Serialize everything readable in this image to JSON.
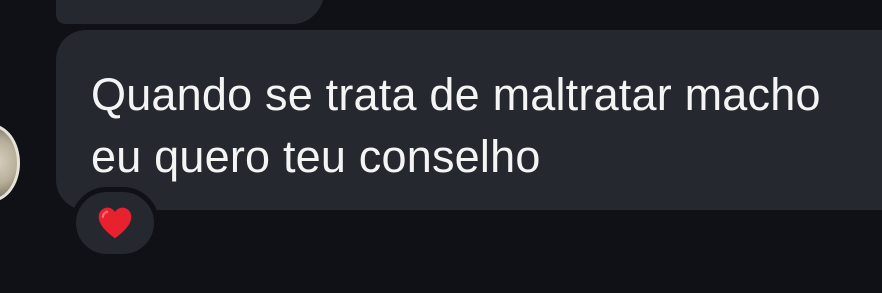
{
  "conversation": {
    "message": {
      "text": "Quando se trata de maltratar macho\neu quero teu conselho",
      "reaction": {
        "icon": "heart-icon",
        "color": "#e8212e"
      }
    },
    "colors": {
      "background": "#0f1116",
      "bubble": "#25282e",
      "text": "#f4f4f5"
    }
  }
}
